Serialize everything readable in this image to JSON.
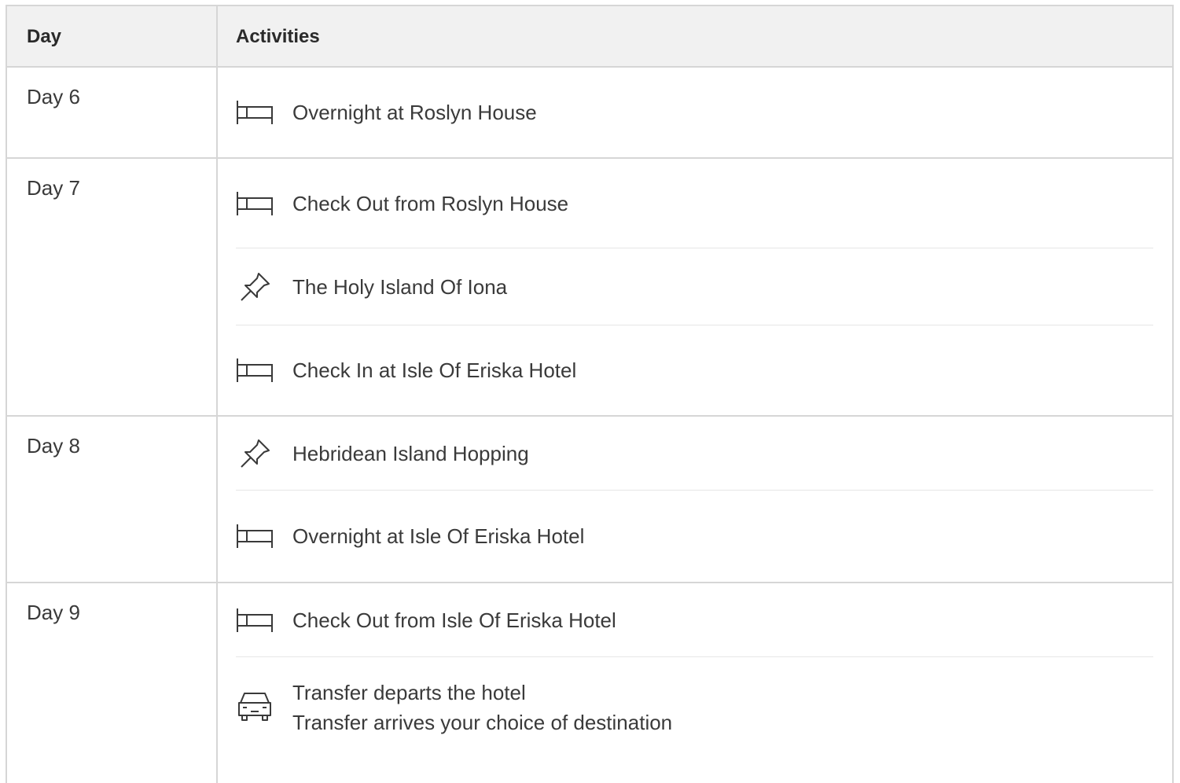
{
  "table": {
    "headers": {
      "day": "Day",
      "activities": "Activities"
    },
    "days": [
      {
        "label": "Day 6",
        "activities": [
          {
            "icon": "bed-icon",
            "text": "Overnight at Roslyn House"
          }
        ]
      },
      {
        "label": "Day 7",
        "activities": [
          {
            "icon": "bed-icon",
            "text": "Check Out from Roslyn House"
          },
          {
            "icon": "pushpin-icon",
            "text": "The Holy Island Of Iona"
          },
          {
            "icon": "bed-icon",
            "text": "Check In at Isle Of Eriska Hotel"
          }
        ]
      },
      {
        "label": "Day 8",
        "activities": [
          {
            "icon": "pushpin-icon",
            "text": "Hebridean Island Hopping"
          },
          {
            "icon": "bed-icon",
            "text": "Overnight at Isle Of Eriska Hotel"
          }
        ]
      },
      {
        "label": "Day 9",
        "activities": [
          {
            "icon": "bed-icon",
            "text": "Check Out from Isle Of Eriska Hotel"
          },
          {
            "icon": "car-icon",
            "lines": [
              "Transfer departs the hotel",
              "Transfer arrives your choice of destination"
            ]
          }
        ]
      }
    ]
  }
}
